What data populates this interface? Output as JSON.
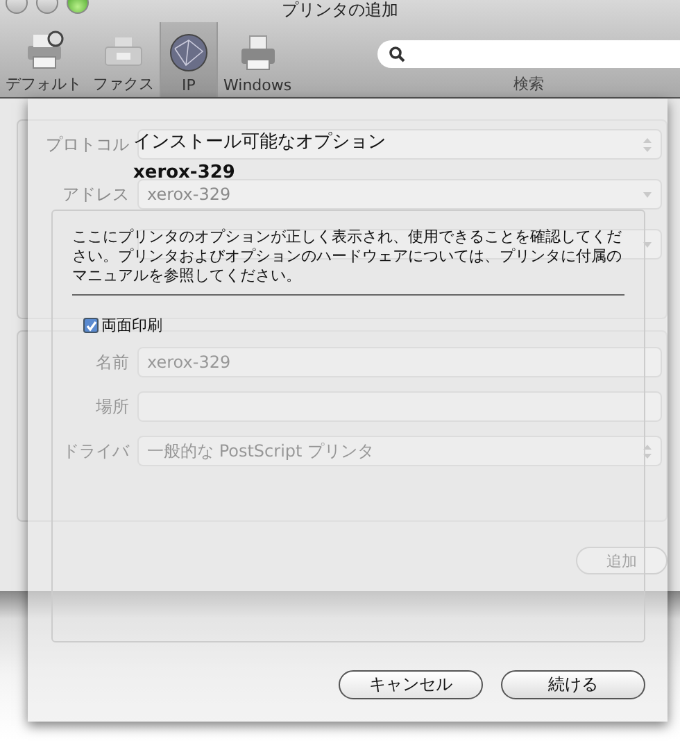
{
  "window": {
    "title": "プリンタの追加"
  },
  "toolbar": {
    "items": [
      {
        "kind": "default",
        "label": "デフォルト",
        "selected": false
      },
      {
        "kind": "fax",
        "label": "ファクス",
        "selected": false
      },
      {
        "kind": "ip",
        "label": "IP",
        "selected": true
      },
      {
        "kind": "windows",
        "label": "Windows",
        "selected": false
      }
    ],
    "search": {
      "label": "検索"
    }
  },
  "form": {
    "groups": [
      [
        {
          "kind": "popup",
          "label": "プロトコル"
        },
        {
          "kind": "combo",
          "label": "アドレス",
          "value": "xerox-329"
        },
        {
          "kind": "combo"
        }
      ],
      [
        {
          "kind": "text",
          "label": "名前",
          "value": "xerox-329"
        },
        {
          "kind": "text",
          "label": "場所"
        },
        {
          "kind": "popup",
          "label": "ドライバ",
          "value": "一般的な PostScript プリンタ"
        }
      ]
    ],
    "add_button": {
      "label": "追加",
      "disabled": true
    }
  },
  "sheet": {
    "title": "インストール可能なオプション",
    "subtitle": "xerox-329",
    "description": "ここにプリンタのオプションが正しく表示され、使用できることを確認してください。プリンタおよびオプションのハードウェアについては、プリンタに付属のマニュアルを参照してください。",
    "options": [
      {
        "label": "両面印刷",
        "checked": true
      }
    ],
    "buttons": [
      {
        "kind": "cancel",
        "label": "キャンセル"
      },
      {
        "kind": "default",
        "label": "続ける"
      }
    ]
  }
}
